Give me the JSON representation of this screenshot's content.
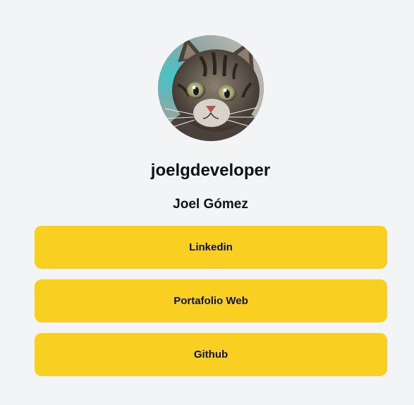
{
  "profile": {
    "avatar_alt": "kitten photo",
    "username": "joelgdeveloper",
    "full_name": "Joel Gómez"
  },
  "links": [
    {
      "label": "Linkedin"
    },
    {
      "label": "Portafolio Web"
    },
    {
      "label": "Github"
    }
  ],
  "colors": {
    "background": "#f3f4f6",
    "button": "#f9d022",
    "text": "#111111"
  }
}
